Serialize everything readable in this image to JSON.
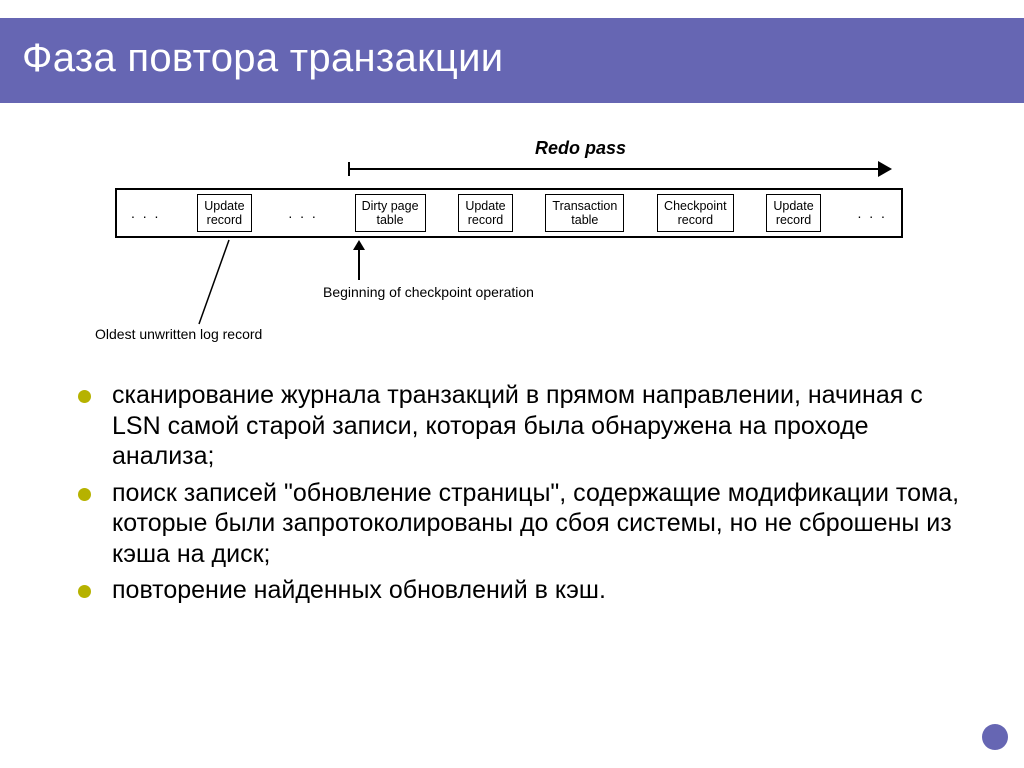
{
  "title": "Фаза повтора транзакции",
  "diagram": {
    "redo_label": "Redo pass",
    "records": [
      "Update\nrecord",
      "Dirty page\ntable",
      "Update\nrecord",
      "Transaction\ntable",
      "Checkpoint\nrecord",
      "Update\nrecord"
    ],
    "ellipsis": ". . .",
    "ann_checkpoint": "Beginning of checkpoint operation",
    "ann_oldest": "Oldest unwritten log record"
  },
  "bullets": [
    "сканирование журнала транзакций в прямом направлении, начиная с LSN самой старой записи, которая была обнаружена на проходе анализа;",
    "поиск записей \"обновление страницы\", содержащие модификации тома, которые были запротоколированы до сбоя системы, но не сброшены из кэша на диск;",
    "повторение найденных обновлений в кэш."
  ]
}
